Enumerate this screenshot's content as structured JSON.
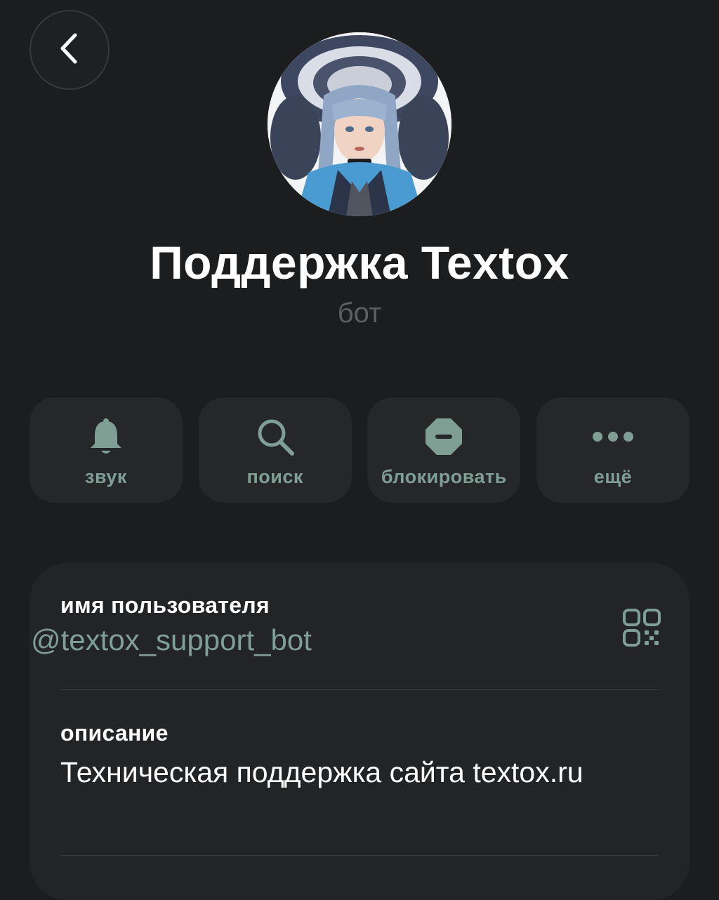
{
  "header": {
    "back_icon": "chevron-left-icon"
  },
  "profile": {
    "avatar_icon": "bot-avatar-illustration",
    "name": "Поддержка Textox",
    "subtitle": "бот"
  },
  "actions": [
    {
      "label": "звук",
      "icon": "bell-icon"
    },
    {
      "label": "поиск",
      "icon": "search-icon"
    },
    {
      "label": "блокировать",
      "icon": "block-icon"
    },
    {
      "label": "ещё",
      "icon": "more-dots-icon"
    }
  ],
  "info": {
    "username_label": "имя пользователя",
    "username_value": "@textox_support_bot",
    "qr_icon": "qr-code-icon",
    "description_label": "описание",
    "description_value": "Техническая поддержка сайта textox.ru"
  },
  "colors": {
    "background": "#1c1d1f",
    "card": "#262729",
    "accent": "#7f9f95",
    "muted": "#5b5e62"
  }
}
